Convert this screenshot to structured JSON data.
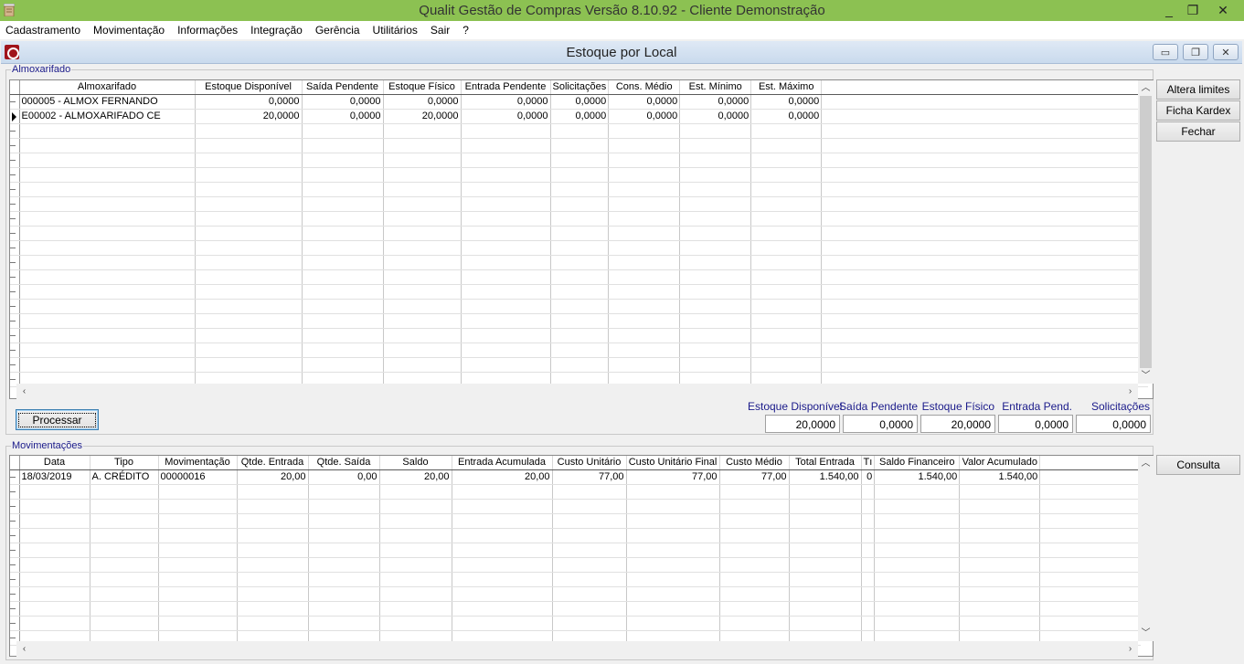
{
  "app": {
    "title": "Qualit Gestão de Compras Versão 8.10.92 - Cliente Demonstração",
    "minimize": "_",
    "restore": "❐",
    "close": "✕"
  },
  "menu": [
    "Cadastramento",
    "Movimentação",
    "Informações",
    "Integração",
    "Gerência",
    "Utilitários",
    "Sair",
    "?"
  ],
  "window": {
    "title": "Estoque por Local",
    "minimize": "▭",
    "restore": "❐",
    "close": "✕"
  },
  "almoxarifado": {
    "group_label": "Almoxarifado",
    "columns": [
      "Almoxarifado",
      "Estoque Disponível",
      "Saída Pendente",
      "Estoque Físico",
      "Entrada Pendente",
      "Solicitações",
      "Cons. Médio",
      "Est. Mínimo",
      "Est. Máximo"
    ],
    "rows": [
      [
        "000005 - ALMOX FERNANDO",
        "0,0000",
        "0,0000",
        "0,0000",
        "0,0000",
        "0,0000",
        "0,0000",
        "0,0000",
        "0,0000"
      ],
      [
        "E00002 - ALMOXARIFADO CE",
        "20,0000",
        "0,0000",
        "20,0000",
        "0,0000",
        "0,0000",
        "0,0000",
        "0,0000",
        "0,0000"
      ]
    ],
    "selected_row": 1
  },
  "side_buttons": {
    "altera_limites": "Altera limites",
    "ficha_kardex": "Ficha Kardex",
    "fechar": "Fechar",
    "consulta": "Consulta"
  },
  "processar_label": "Processar",
  "totals": {
    "labels": [
      "Estoque Disponível",
      "Saída Pendente",
      "Estoque Físico",
      "Entrada Pend.",
      "Solicitações"
    ],
    "values": [
      "20,0000",
      "0,0000",
      "20,0000",
      "0,0000",
      "0,0000"
    ]
  },
  "movimentacoes": {
    "group_label": "Movimentações",
    "columns": [
      "Data",
      "Tipo",
      "Movimentação",
      "Qtde. Entrada",
      "Qtde. Saída",
      "Saldo",
      "Entrada Acumulada",
      "Custo Unitário",
      "Custo Unitário Final",
      "Custo Médio",
      "Total Entrada",
      "Tı",
      "Saldo Financeiro",
      "Valor Acumulado"
    ],
    "rows": [
      [
        "18/03/2019",
        "A. CRÉDITO",
        "00000016",
        "20,00",
        "0,00",
        "20,00",
        "20,00",
        "77,00",
        "77,00",
        "77,00",
        "1.540,00",
        "0",
        "1.540,00",
        "1.540,00"
      ]
    ]
  },
  "colors": {
    "app_titlebar": "#8cc152",
    "group_label": "#1a1a8a",
    "window_caption": "#c9daed"
  },
  "icons": {
    "row_indicator": "triangle-right-icon",
    "scroll_up": "chevron-up-icon",
    "scroll_down": "chevron-down-icon",
    "scroll_left": "chevron-left-icon",
    "scroll_right": "chevron-right-icon"
  }
}
